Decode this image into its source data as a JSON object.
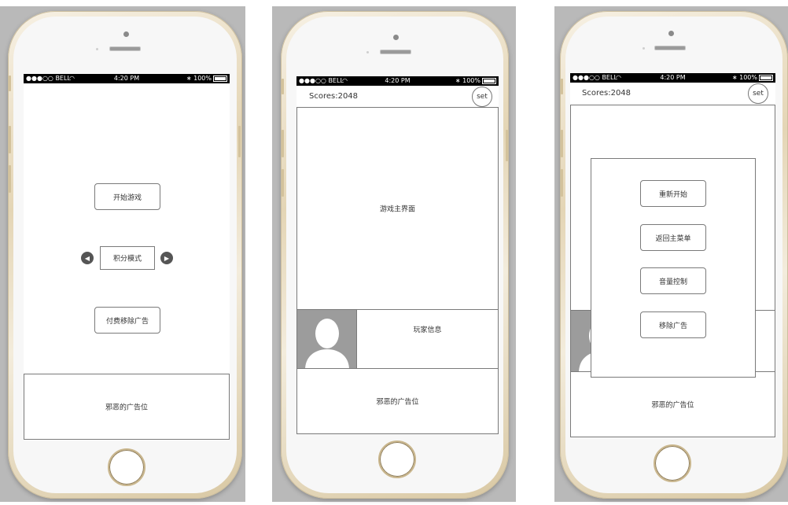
{
  "status_bar": {
    "carrier": "●●●○○ BELL",
    "wifi_icon": "wifi-icon",
    "time": "4:20 PM",
    "bluetooth_icon": "bluetooth-icon",
    "battery": "100%"
  },
  "screen1": {
    "start_button": "开始游戏",
    "mode_label": "积分模式",
    "prev_icon": "chevron-left-icon",
    "next_icon": "chevron-right-icon",
    "remove_ads_button": "付费移除广告",
    "ad_slot": "邪恶的广告位"
  },
  "screen2": {
    "scores": "Scores:2048",
    "set_button": "set",
    "main_area": "游戏主界面",
    "player_info": "玩家信息",
    "avatar_icon": "user-avatar-icon",
    "ad_slot": "邪恶的广告位"
  },
  "screen3": {
    "scores": "Scores:2048",
    "set_button": "set",
    "menu": [
      "重新开始",
      "返回主菜单",
      "音量控制",
      "移除广告"
    ],
    "ad_slot": "邪恶的广告位"
  },
  "colors": {
    "gold_frame": "#e4d5b5",
    "screen_bg": "#ffffff",
    "status_bar": "#000000",
    "avatar_bg": "#9c9c9c",
    "border": "#7a7a7a"
  }
}
